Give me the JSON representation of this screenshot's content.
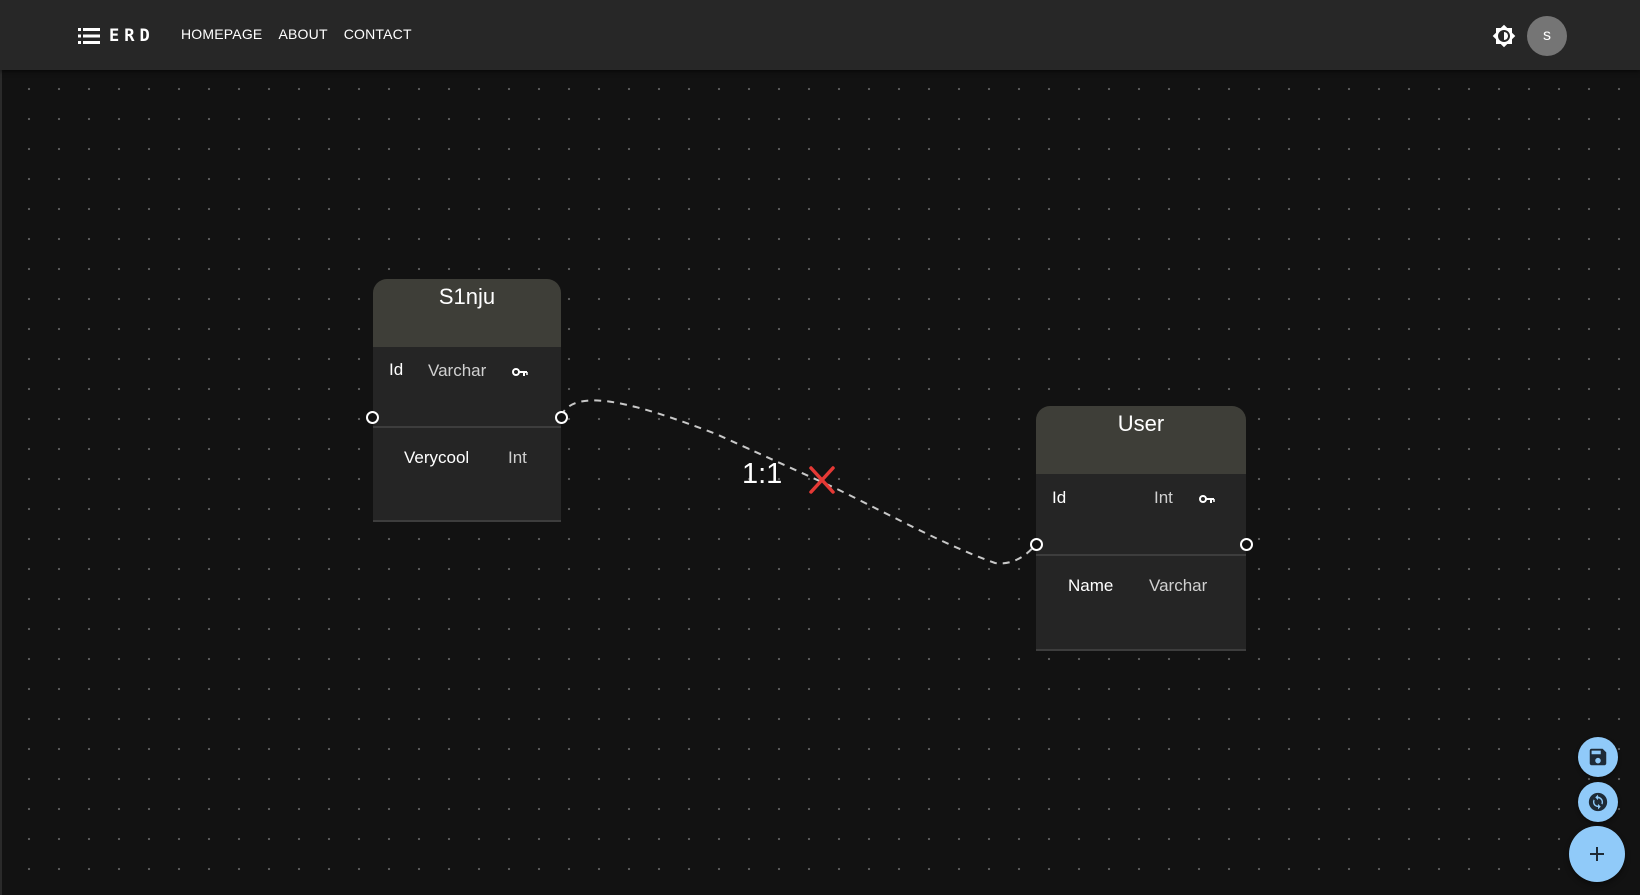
{
  "navbar": {
    "brand": "ERD",
    "links": [
      "HOMEPAGE",
      "ABOUT",
      "CONTACT"
    ],
    "avatar_initial": "s",
    "icons": {
      "brand": "list-icon",
      "theme": "brightness-icon"
    }
  },
  "diagram": {
    "tables": [
      {
        "name": "S1nju",
        "columns": [
          {
            "name": "Id",
            "type": "Varchar",
            "primary_key": true
          },
          {
            "name": "Verycool",
            "type": "Int",
            "primary_key": false
          }
        ]
      },
      {
        "name": "User",
        "columns": [
          {
            "name": "Id",
            "type": "Int",
            "primary_key": true
          },
          {
            "name": "Name",
            "type": "Varchar",
            "primary_key": false
          }
        ]
      }
    ],
    "relations": [
      {
        "from": "S1nju",
        "to": "User",
        "label": "1:1",
        "delete_icon": "close-icon",
        "delete_color": "#e53935"
      }
    ]
  },
  "fabs": {
    "save_icon": "save-icon",
    "sync_icon": "sync-icon",
    "add_icon": "add-icon",
    "color": "#90caf9"
  }
}
